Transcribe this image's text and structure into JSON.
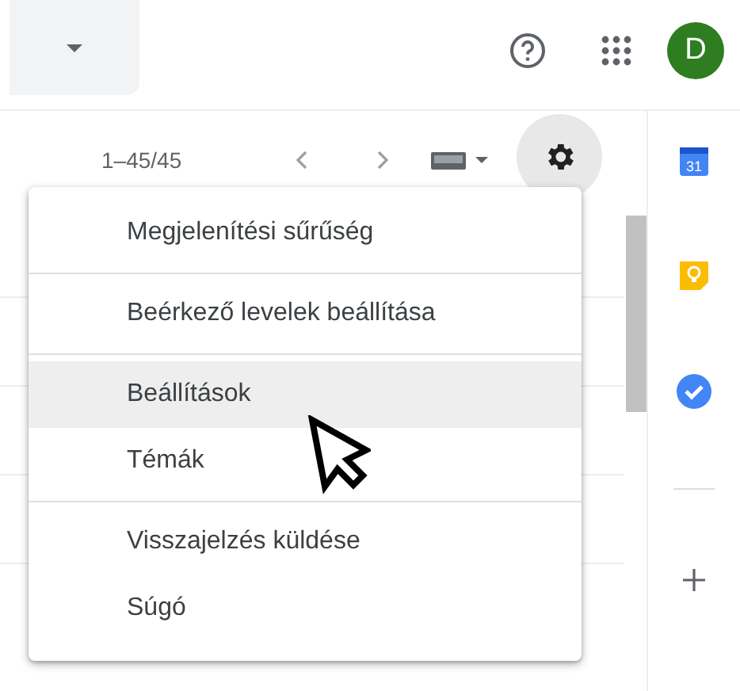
{
  "header": {
    "avatar": "D"
  },
  "toolbar": {
    "page_range": "1–45/45"
  },
  "settings_menu": {
    "sections": [
      [
        {
          "label": "Megjelenítési sűrűség",
          "selected": false
        }
      ],
      [
        {
          "label": "Beérkező levelek beállítása",
          "selected": false
        }
      ],
      [
        {
          "label": "Beállítások",
          "selected": true
        },
        {
          "label": "Témák",
          "selected": false
        }
      ],
      [
        {
          "label": "Visszajelzés küldése",
          "selected": false
        },
        {
          "label": "Súgó",
          "selected": false
        }
      ]
    ]
  },
  "side_panel": {
    "apps": [
      {
        "kind": "calendar",
        "label": "31"
      },
      {
        "kind": "keep"
      },
      {
        "kind": "tasks"
      }
    ]
  }
}
